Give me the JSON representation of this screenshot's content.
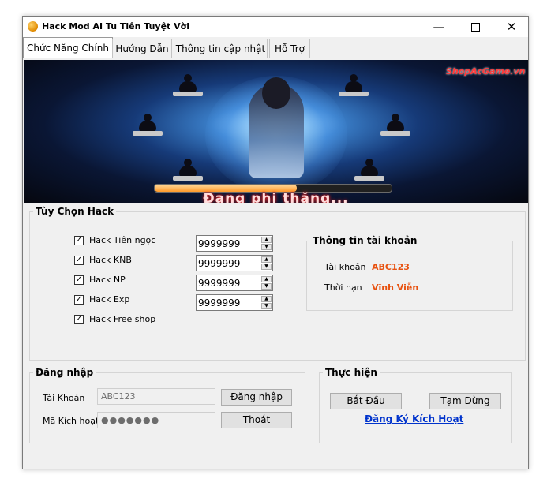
{
  "window": {
    "title": "Hack Mod AI Tu Tiên Tuyệt Vời",
    "controls": {
      "minimize": "—",
      "close": "✕"
    }
  },
  "tabs": [
    {
      "label": "Chức Năng Chính",
      "active": true
    },
    {
      "label": "Hướng Dẫn",
      "active": false
    },
    {
      "label": "Thông tin cập nhật",
      "active": false
    },
    {
      "label": "Hỗ Trợ",
      "active": false
    }
  ],
  "banner": {
    "watermark": "ShopAcGame.vn",
    "caption": "Đang phi thăng...",
    "progress_fraction": 0.6
  },
  "hack_options": {
    "title": "Tùy Chọn Hack",
    "items": [
      {
        "label": "Hack Tiên ngọc",
        "checked": true,
        "value": "9999999"
      },
      {
        "label": "Hack KNB",
        "checked": true,
        "value": "9999999"
      },
      {
        "label": "Hack NP",
        "checked": true,
        "value": "9999999"
      },
      {
        "label": "Hack Exp",
        "checked": true,
        "value": "9999999"
      },
      {
        "label": "Hack Free shop",
        "checked": true
      }
    ]
  },
  "account_info": {
    "title": "Thông tin tài khoản",
    "account_label": "Tài khoản",
    "account_value": "ABC123",
    "duration_label": "Thời hạn",
    "duration_value": "Vĩnh Viễn"
  },
  "login": {
    "title": "Đăng nhập",
    "account_label": "Tài Khoản",
    "account_value": "ABC123",
    "code_label": "Mã Kích hoạt",
    "code_value": "●●●●●●●",
    "login_button": "Đăng nhập",
    "exit_button": "Thoát"
  },
  "execute": {
    "title": "Thực hiện",
    "start_button": "Bắt Đầu",
    "pause_button": "Tạm Dừng",
    "register_link": "Đăng Ký Kích Hoạt"
  },
  "colors": {
    "accent_orange": "#e8510f",
    "link_blue": "#0033cc"
  }
}
